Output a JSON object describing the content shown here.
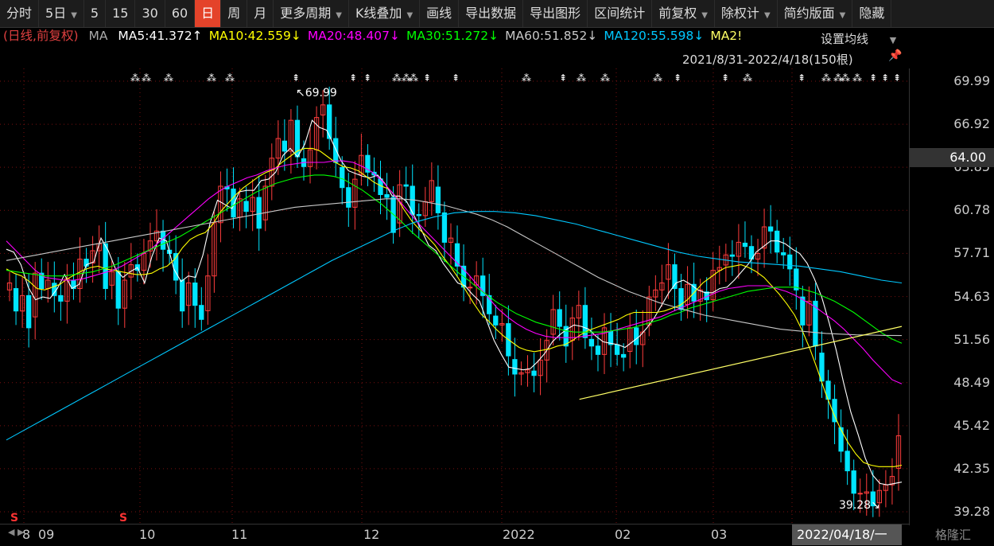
{
  "toolbar": {
    "items": [
      "分时",
      "5日",
      "5",
      "15",
      "30",
      "60",
      "日",
      "周",
      "月",
      "更多周期",
      "K线叠加",
      "画线",
      "导出数据",
      "导出图形",
      "区间统计",
      "前复权",
      "除权计",
      "简约版面",
      "隐藏"
    ],
    "active": "日"
  },
  "ma_row": {
    "title": "(日线,前复权)",
    "ma_label": "MA",
    "entries": [
      {
        "text": "MA5:41.372↑",
        "color": "#ffffff"
      },
      {
        "text": "MA10:42.559↓",
        "color": "#ffff00"
      },
      {
        "text": "MA20:48.407↓",
        "color": "#ff00ff"
      },
      {
        "text": "MA30:51.272↓",
        "color": "#00ff00"
      },
      {
        "text": "MA60:51.852↓",
        "color": "#c8c8c8"
      },
      {
        "text": "MA120:55.598↓",
        "color": "#00c8ff"
      },
      {
        "text": "MA2!",
        "color": "#ffff66"
      }
    ],
    "settings_label": "设置均线",
    "range_label": "2021/8/31-2022/4/18(150根)"
  },
  "chart_data": {
    "type": "candlestick",
    "ylim": [
      39.28,
      69.99
    ],
    "y_ticks": [
      "69.99",
      "66.92",
      "63.85",
      "60.78",
      "57.71",
      "54.63",
      "51.56",
      "48.49",
      "45.42",
      "42.35",
      "39.28"
    ],
    "x_labels": [
      "8",
      "09",
      "10",
      "11",
      "12",
      "2022",
      "02",
      "03",
      "2022/04/18/一"
    ],
    "current_price": "64.00",
    "annotations": [
      "69.99",
      "39.28"
    ],
    "closes": [
      55.6,
      53.6,
      54.7,
      52.4,
      56.3,
      55.2,
      55.8,
      54.7,
      54.3,
      55.9,
      55.2,
      57.3,
      56.8,
      57.9,
      58.4,
      55.2,
      56.4,
      53.8,
      55.8,
      56.9,
      56.5,
      57.7,
      58.6,
      59.3,
      58.0,
      57.7,
      55.8,
      53.6,
      55.6,
      54.0,
      53.0,
      56.1,
      59.9,
      62.5,
      62.3,
      60.3,
      61.6,
      60.7,
      61.7,
      59.5,
      62.5,
      64.5,
      65.9,
      65.0,
      67.2,
      64.6,
      63.9,
      65.1,
      67.4,
      68.3,
      65.9,
      64.2,
      62.4,
      61.0,
      63.0,
      64.7,
      63.5,
      63.3,
      61.9,
      61.7,
      59.2,
      62.6,
      62.5,
      60.5,
      60.4,
      61.4,
      62.9,
      60.6,
      58.5,
      58.8,
      56.8,
      55.3,
      55.3,
      56.1,
      54.7,
      53.4,
      52.6,
      52.7,
      50.4,
      49.1,
      49.2,
      49.4,
      49.0,
      50.1,
      51.5,
      53.7,
      52.5,
      51.1,
      53.1,
      54.0,
      51.7,
      51.1,
      50.5,
      52.4,
      51.2,
      50.5,
      50.3,
      52.4,
      51.2,
      52.1,
      54.6,
      55.1,
      55.6,
      56.9,
      55.2,
      53.7,
      55.5,
      54.3,
      55.1,
      54.4,
      56.5,
      56.7,
      57.6,
      57.5,
      58.5,
      58.2,
      57.3,
      57.7,
      59.6,
      59.3,
      57.8,
      57.6,
      56.6,
      55.1,
      52.6,
      54.3,
      51.1,
      48.6,
      47.3,
      45.7,
      43.6,
      42.2,
      40.6,
      40.6,
      40.7,
      39.7,
      40.8,
      41.2,
      41.8,
      44.7
    ],
    "series": [
      {
        "name": "MA5",
        "color": "#ffffff",
        "values": [
          58.0,
          57.8,
          56.9,
          55.3,
          54.4,
          54.6,
          54.5,
          55.2,
          56.2,
          55.2,
          55.5,
          56.9,
          57.1,
          58.8,
          57.9,
          56.6,
          56.0,
          56.4,
          56.7,
          55.6,
          57.5,
          58.8,
          58.6,
          56.6,
          55.7,
          56.1,
          56.0,
          57.6,
          59.9,
          61.5,
          61.2,
          60.9,
          62.1,
          62.2,
          62.2,
          62.9,
          63.0,
          63.5,
          64.7,
          65.2,
          64.6,
          65.5,
          67.2,
          66.7,
          66.5,
          65.4,
          64.3,
          63.6,
          63.4,
          63.2,
          63.1,
          63.3,
          62.7,
          61.8,
          61.8,
          61.4,
          60.4,
          59.4,
          58.3,
          57.9,
          57.0,
          56.3,
          55.6,
          55.4,
          54.8,
          54.3,
          52.9,
          51.5,
          50.5,
          49.6,
          49.5,
          49.4,
          49.5,
          50.0,
          50.6,
          51.4,
          51.9,
          52.3,
          52.6,
          52.5,
          52.3,
          51.8,
          51.4,
          51.3,
          51.2,
          51.0,
          51.4,
          51.8,
          52.4,
          53.1,
          54.0,
          54.9,
          55.6,
          55.8,
          55.5,
          55.1,
          54.9,
          54.9,
          55.2,
          55.3,
          55.8,
          56.4,
          57.0,
          57.8,
          58.2,
          58.6,
          58.6,
          58.4,
          58.0,
          57.7,
          57.0,
          55.9,
          54.6,
          52.8,
          50.8,
          48.5,
          46.4,
          44.8,
          43.1,
          41.9,
          41.3,
          41.2,
          41.3,
          41.4
        ]
      },
      {
        "name": "MA10",
        "color": "#ffff00",
        "values": [
          56.6,
          56.3,
          56.1,
          55.7,
          55.2,
          55.1,
          55.3,
          55.5,
          55.9,
          56.2,
          56.5,
          56.7,
          56.8,
          56.6,
          56.5,
          56.4,
          56.3,
          56.2,
          56.2,
          56.3,
          56.6,
          56.8,
          57.3,
          58.1,
          58.7,
          59.0,
          59.2,
          59.8,
          60.7,
          61.3,
          61.9,
          62.4,
          62.8,
          63.2,
          63.5,
          63.7,
          64.2,
          64.6,
          65.0,
          65.2,
          65.2,
          65.0,
          64.6,
          64.2,
          63.9,
          63.8,
          63.6,
          63.2,
          62.8,
          62.5,
          62.3,
          61.7,
          60.8,
          60.0,
          59.4,
          58.9,
          58.3,
          57.5,
          56.8,
          56.0,
          55.1,
          54.2,
          53.4,
          52.9,
          52.3,
          51.8,
          51.4,
          51.0,
          50.8,
          50.7,
          50.8,
          50.9,
          51.1,
          51.2,
          51.5,
          51.9,
          52.2,
          52.4,
          52.6,
          52.8,
          53.0,
          53.3,
          53.5,
          53.5,
          53.5,
          53.5,
          53.6,
          53.8,
          54.0,
          54.4,
          55.0,
          55.6,
          56.0,
          56.4,
          56.7,
          56.8,
          56.9,
          56.7,
          56.4,
          56.0,
          55.4,
          54.8,
          54.1,
          53.3,
          52.2,
          50.9,
          49.4,
          47.8,
          46.4,
          45.2,
          44.2,
          43.4,
          42.8,
          42.6,
          42.5,
          42.5,
          42.5,
          42.6
        ]
      },
      {
        "name": "MA20",
        "color": "#ff00ff",
        "values": [
          58.6,
          57.9,
          57.2,
          56.5,
          56.0,
          55.9,
          55.8,
          55.8,
          55.9,
          56.1,
          56.3,
          56.5,
          56.8,
          57.2,
          57.6,
          58.0,
          58.6,
          59.2,
          59.8,
          60.4,
          61.0,
          61.6,
          62.1,
          62.5,
          62.8,
          63.1,
          63.3,
          63.6,
          63.8,
          64.0,
          64.1,
          64.2,
          64.2,
          64.2,
          64.3,
          64.3,
          64.2,
          63.9,
          63.5,
          62.9,
          62.1,
          61.3,
          60.5,
          59.7,
          59.0,
          58.3,
          57.6,
          56.9,
          56.2,
          55.4,
          54.6,
          53.8,
          53.2,
          52.7,
          52.3,
          52.0,
          51.8,
          51.7,
          51.7,
          51.7,
          51.8,
          51.9,
          52.0,
          52.2,
          52.4,
          52.6,
          52.8,
          53.0,
          53.2,
          53.5,
          53.8,
          54.1,
          54.4,
          54.7,
          55.0,
          55.2,
          55.3,
          55.4,
          55.4,
          55.4,
          55.2,
          55.0,
          54.7,
          54.3,
          53.9,
          53.4,
          52.9,
          52.3,
          51.6,
          50.9,
          50.1,
          49.4,
          48.7,
          48.4
        ]
      },
      {
        "name": "MA30",
        "color": "#00ff00",
        "values": [
          56.5,
          56.4,
          56.3,
          56.2,
          56.1,
          56.1,
          56.1,
          56.2,
          56.3,
          56.4,
          56.6,
          56.8,
          57.1,
          57.4,
          57.7,
          58.0,
          58.3,
          58.6,
          58.9,
          59.3,
          59.7,
          60.1,
          60.5,
          60.9,
          61.3,
          61.7,
          62.1,
          62.4,
          62.7,
          62.9,
          63.1,
          63.2,
          63.3,
          63.3,
          63.2,
          63.0,
          62.6,
          62.2,
          61.7,
          61.2,
          60.6,
          60.0,
          59.3,
          58.7,
          58.1,
          57.5,
          56.9,
          56.3,
          55.8,
          55.2,
          54.7,
          54.2,
          53.8,
          53.4,
          53.1,
          52.8,
          52.6,
          52.4,
          52.2,
          52.1,
          52.1,
          52.1,
          52.1,
          52.2,
          52.3,
          52.4,
          52.6,
          52.8,
          53.0,
          53.3,
          53.5,
          53.8,
          54.0,
          54.2,
          54.4,
          54.6,
          54.8,
          55.0,
          55.1,
          55.2,
          55.3,
          55.3,
          55.3,
          55.1,
          54.9,
          54.6,
          54.3,
          53.9,
          53.5,
          53.0,
          52.5,
          52.0,
          51.6,
          51.3
        ]
      },
      {
        "name": "MA60",
        "color": "#c8c8c8",
        "values": [
          57.2,
          57.4,
          57.6,
          57.8,
          58.0,
          58.2,
          58.4,
          58.6,
          58.8,
          59.0,
          59.2,
          59.4,
          59.6,
          59.8,
          60.0,
          60.2,
          60.4,
          60.6,
          60.8,
          61.0,
          61.1,
          61.2,
          61.3,
          61.4,
          61.5,
          61.6,
          61.6,
          61.5,
          61.3,
          61.1,
          60.8,
          60.5,
          60.1,
          59.6,
          59.0,
          58.4,
          57.8,
          57.2,
          56.6,
          56.0,
          55.5,
          55.0,
          54.6,
          54.2,
          53.9,
          53.6,
          53.3,
          53.1,
          52.9,
          52.7,
          52.5,
          52.3,
          52.2,
          52.1,
          52.0,
          51.95,
          51.9,
          51.88,
          51.86,
          51.85
        ]
      },
      {
        "name": "MA120",
        "color": "#00c8ff",
        "values": [
          44.4,
          45.2,
          46.0,
          46.8,
          47.6,
          48.4,
          49.2,
          50.0,
          50.8,
          51.6,
          52.4,
          53.2,
          54.0,
          54.8,
          55.6,
          56.4,
          57.2,
          57.9,
          58.6,
          59.3,
          59.9,
          60.3,
          60.6,
          60.7,
          60.7,
          60.6,
          60.4,
          60.1,
          59.8,
          59.4,
          59.0,
          58.6,
          58.2,
          57.8,
          57.5,
          57.3,
          57.1,
          57.0,
          56.9,
          56.8,
          56.6,
          56.4,
          56.1,
          55.8,
          55.6
        ]
      }
    ],
    "trendline": {
      "x": [
        0.64,
        1.0
      ],
      "y": [
        47.3,
        52.5
      ]
    }
  },
  "footer": {
    "nav": "◀ ▶",
    "end_date": "2022/04/18/一",
    "watermark": "格隆汇"
  }
}
